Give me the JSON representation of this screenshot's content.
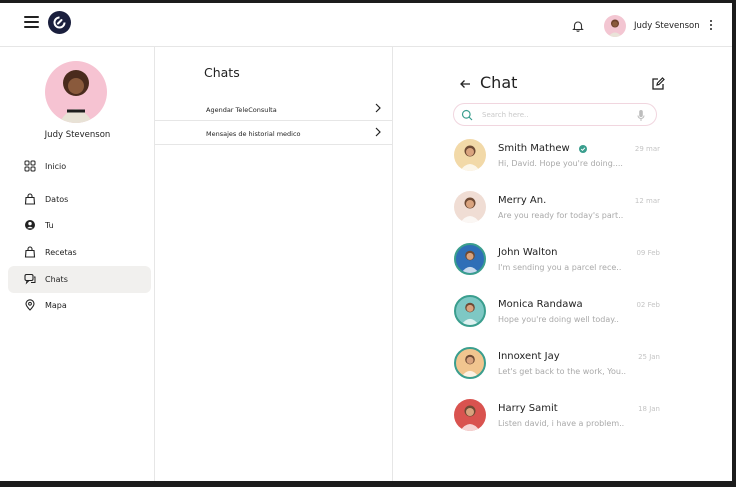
{
  "header": {
    "user_name": "Judy Stevenson"
  },
  "sidebar": {
    "profile_name": "Judy Stevenson",
    "items": [
      {
        "label": "Inicio",
        "icon": "grid-icon"
      },
      {
        "label": "Datos",
        "icon": "bag-icon"
      },
      {
        "label": "Tu",
        "icon": "user-circle-icon"
      },
      {
        "label": "Recetas",
        "icon": "bag-icon"
      },
      {
        "label": "Chats",
        "icon": "chat-bubbles-icon",
        "active": true
      },
      {
        "label": "Mapa",
        "icon": "location-pin-icon"
      }
    ]
  },
  "middle": {
    "title": "Chats",
    "items": [
      {
        "label": "Agendar TeleConsulta"
      },
      {
        "label": "Mensajes de historial medico"
      }
    ]
  },
  "chat_panel": {
    "title": "Chat",
    "search_placeholder": "Search here..",
    "conversations": [
      {
        "name": "Smith Mathew",
        "date": "29 mar",
        "message": "Hi, David. Hope you're doing....",
        "verified": true,
        "avatar_bg": "#f2d9a8",
        "ring": false
      },
      {
        "name": "Merry An.",
        "date": "12 mar",
        "message": "Are you ready for today's part..",
        "verified": false,
        "avatar_bg": "#f0ddd4",
        "ring": false
      },
      {
        "name": "John Walton",
        "date": "09 Feb",
        "message": "I'm sending you a parcel rece..",
        "verified": false,
        "avatar_bg": "#2f6fb7",
        "ring": true
      },
      {
        "name": "Monica Randawa",
        "date": "02 Feb",
        "message": "Hope you're doing well today..",
        "verified": false,
        "avatar_bg": "#7ec8c4",
        "ring": true
      },
      {
        "name": "Innoxent Jay",
        "date": "25 Jan",
        "message": "Let's get back to the work, You..",
        "verified": false,
        "avatar_bg": "#f1c58f",
        "ring": true
      },
      {
        "name": "Harry Samit",
        "date": "18 Jan",
        "message": "Listen david, i have a problem..",
        "verified": false,
        "avatar_bg": "#d9534f",
        "ring": false
      }
    ]
  },
  "colors": {
    "accent_teal": "#3a9e8e",
    "active_nav_bg": "#f1f0ee",
    "logo_bg": "#1a1f3d",
    "avatar_pink": "#f6c3d2"
  }
}
